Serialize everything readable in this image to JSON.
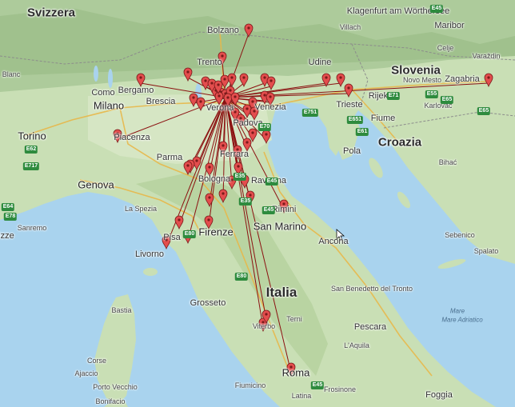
{
  "map": {
    "country_labels": [
      {
        "name": "country-svizzera",
        "text": "Svizzera",
        "cls": "country"
      },
      {
        "name": "country-slovenia",
        "text": "Slovenia",
        "cls": "country"
      },
      {
        "name": "country-croazia",
        "text": "Croazia",
        "cls": "country"
      },
      {
        "name": "country-italia",
        "text": "Italia",
        "cls": "country country-lg"
      },
      {
        "name": "country-san-marino",
        "text": "San Marino",
        "cls": "city-l"
      }
    ],
    "city_labels": [
      {
        "text": "Klagenfurt am Wörthersee",
        "cls": "city-m"
      },
      {
        "text": "Maribor",
        "cls": "city-m"
      },
      {
        "text": "Villach",
        "cls": "city-s"
      },
      {
        "text": "Celje",
        "cls": "city-s"
      },
      {
        "text": "Bolzano",
        "cls": "city-m"
      },
      {
        "text": "Trento",
        "cls": "city-m"
      },
      {
        "text": "Udine",
        "cls": "city-m"
      },
      {
        "text": "Varaždin",
        "cls": "city-s"
      },
      {
        "text": "Bergamo",
        "cls": "city-m"
      },
      {
        "text": "Como",
        "cls": "city-m"
      },
      {
        "text": "Brescia",
        "cls": "city-m"
      },
      {
        "text": "Milano",
        "cls": "city-l"
      },
      {
        "text": "Verona",
        "cls": "city-m"
      },
      {
        "text": "Venezia",
        "cls": "city-m"
      },
      {
        "text": "Padova",
        "cls": "city-m"
      },
      {
        "text": "Trieste",
        "cls": "city-m"
      },
      {
        "text": "Novo Mesto",
        "cls": "city-s"
      },
      {
        "text": "Zagabria",
        "cls": "city-m"
      },
      {
        "text": "Karlovac",
        "cls": "city-s"
      },
      {
        "text": "Rijeka",
        "cls": "city-m"
      },
      {
        "text": "Fiume",
        "cls": "city-m"
      },
      {
        "text": "Torino",
        "cls": "city-l"
      },
      {
        "text": "Piacenza",
        "cls": "city-m"
      },
      {
        "text": "Parma",
        "cls": "city-m"
      },
      {
        "text": "Ferrara",
        "cls": "city-m"
      },
      {
        "text": "Pola",
        "cls": "city-m"
      },
      {
        "text": "Genova",
        "cls": "city-l"
      },
      {
        "text": "Bologna",
        "cls": "city-m"
      },
      {
        "text": "Ravenna",
        "cls": "city-m"
      },
      {
        "text": "Bihać",
        "cls": "city-s"
      },
      {
        "text": "La Spezia",
        "cls": "city-s"
      },
      {
        "text": "Rimini",
        "cls": "city-m"
      },
      {
        "text": "Sanremo",
        "cls": "city-s"
      },
      {
        "text": "Pisa",
        "cls": "city-m"
      },
      {
        "text": "Firenze",
        "cls": "city-l"
      },
      {
        "text": "Livorno",
        "cls": "city-m"
      },
      {
        "text": "Ancona",
        "cls": "city-m"
      },
      {
        "text": "Sebenico",
        "cls": "city-s"
      },
      {
        "text": "Spalato",
        "cls": "city-s"
      },
      {
        "text": "San Benedetto del Tronto",
        "cls": "city-s"
      },
      {
        "text": "Grosseto",
        "cls": "city-m"
      },
      {
        "text": "Bastia",
        "cls": "city-s"
      },
      {
        "text": "Terni",
        "cls": "city-s"
      },
      {
        "text": "Viterbo",
        "cls": "city-s"
      },
      {
        "text": "Pescara",
        "cls": "city-m"
      },
      {
        "text": "L'Aquila",
        "cls": "city-s"
      },
      {
        "text": "Corse",
        "cls": "city-s"
      },
      {
        "text": "Ajaccio",
        "cls": "city-s"
      },
      {
        "text": "Porto Vecchio",
        "cls": "city-s"
      },
      {
        "text": "Roma",
        "cls": "city-l"
      },
      {
        "text": "Fiumicino",
        "cls": "city-s"
      },
      {
        "text": "Frosinone",
        "cls": "city-s"
      },
      {
        "text": "Latina",
        "cls": "city-s"
      },
      {
        "text": "Foggia",
        "cls": "city-m"
      },
      {
        "text": "Bonifacio",
        "cls": "city-s"
      },
      {
        "text": "Mare Adriatico",
        "cls": "sea"
      },
      {
        "text": "Mare",
        "cls": "sea"
      },
      {
        "text": "Blanc",
        "cls": "city-s"
      },
      {
        "text": "izze",
        "cls": "city-m"
      }
    ],
    "road_shields": [
      "E45",
      "E70",
      "E61",
      "E55",
      "E65",
      "E62",
      "E64",
      "E717",
      "E35",
      "E80",
      "E651",
      "E71",
      "E751",
      "E45",
      "E45",
      "E35",
      "E80",
      "E45",
      "E65",
      "E78"
    ],
    "colors": {
      "route_line": "#8b1010",
      "marker_fill": "#e34d4d",
      "marker_stroke": "#7a1b1b",
      "water": "#a9d3ee",
      "land": "#c9dfb5"
    }
  }
}
